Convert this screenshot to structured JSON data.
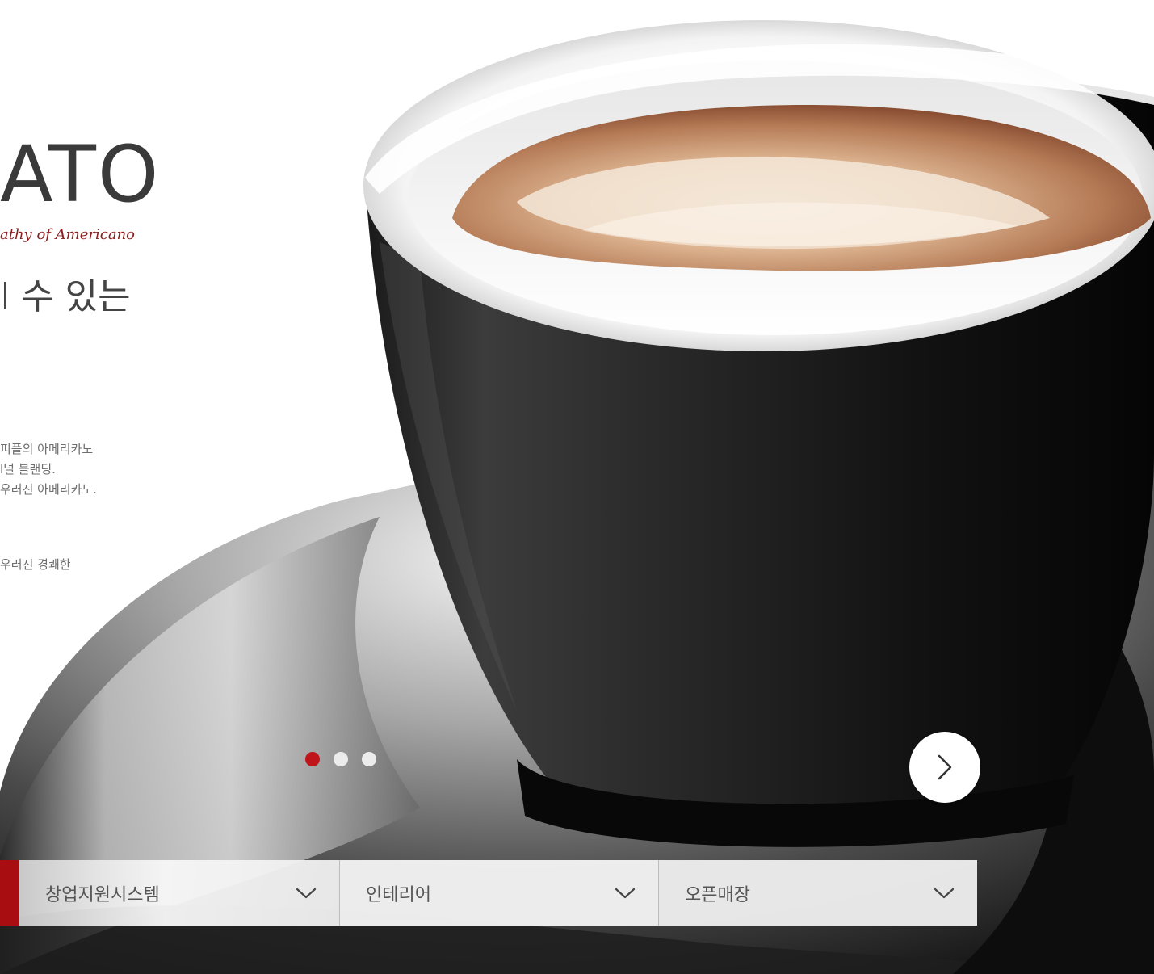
{
  "brand": {
    "logo_text": "ATO",
    "tagline": "athy of Americano"
  },
  "hero": {
    "headline": "l 수 있는",
    "headline_partial": "",
    "description_lines": [
      "피플의 아메리카노",
      "l널 블랜딩.",
      "우러진 아메리카노."
    ],
    "description_2": "우러진 경쾌한"
  },
  "slider": {
    "dots": [
      {
        "state": "active"
      },
      {
        "state": "inactive"
      },
      {
        "state": "inactive"
      }
    ],
    "next_icon": "chevron-right-icon"
  },
  "dropdowns": [
    {
      "label": "창업지원시스템",
      "icon": "chevron-down-icon"
    },
    {
      "label": "인테리어",
      "icon": "chevron-down-icon"
    },
    {
      "label": "오픈매장",
      "icon": "chevron-down-icon"
    }
  ],
  "colors": {
    "accent": "#c0141b",
    "accent_dark": "#a80d12",
    "tagline": "#8c1d1d",
    "cup": "#1c1c1c"
  }
}
